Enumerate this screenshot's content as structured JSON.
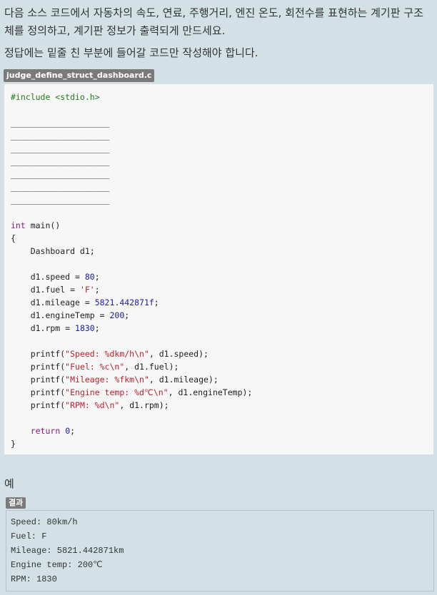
{
  "intro": {
    "paragraph1": "다음 소스 코드에서 자동차의 속도, 연료, 주행거리, 엔진 온도, 회전수를 표현하는 계기판 구조체를 정의하고, 계기판 정보가 출력되게 만드세요.",
    "paragraph2": "정답에는 밑줄 친 부분에 들어갈 코드만 작성해야 합니다."
  },
  "code_file": {
    "filename": "judge_define_struct_dashboard.c",
    "lines": [
      [
        {
          "t": "#include <stdio.h>",
          "c": "pp"
        }
      ],
      [],
      [
        {
          "t": "____________________",
          "c": ""
        }
      ],
      [
        {
          "t": "____________________",
          "c": ""
        }
      ],
      [
        {
          "t": "____________________",
          "c": ""
        }
      ],
      [
        {
          "t": "____________________",
          "c": ""
        }
      ],
      [
        {
          "t": "____________________",
          "c": ""
        }
      ],
      [
        {
          "t": "____________________",
          "c": ""
        }
      ],
      [
        {
          "t": "____________________",
          "c": ""
        }
      ],
      [],
      [
        {
          "t": "int",
          "c": "kw"
        },
        {
          "t": " main()",
          "c": ""
        }
      ],
      [
        {
          "t": "{",
          "c": ""
        }
      ],
      [
        {
          "t": "    Dashboard d1;",
          "c": ""
        }
      ],
      [],
      [
        {
          "t": "    d1.speed = ",
          "c": ""
        },
        {
          "t": "80",
          "c": "num"
        },
        {
          "t": ";",
          "c": ""
        }
      ],
      [
        {
          "t": "    d1.fuel = ",
          "c": ""
        },
        {
          "t": "'F'",
          "c": "str"
        },
        {
          "t": ";",
          "c": ""
        }
      ],
      [
        {
          "t": "    d1.mileage = ",
          "c": ""
        },
        {
          "t": "5821.442871f",
          "c": "num"
        },
        {
          "t": ";",
          "c": ""
        }
      ],
      [
        {
          "t": "    d1.engineTemp = ",
          "c": ""
        },
        {
          "t": "200",
          "c": "num"
        },
        {
          "t": ";",
          "c": ""
        }
      ],
      [
        {
          "t": "    d1.rpm = ",
          "c": ""
        },
        {
          "t": "1830",
          "c": "num"
        },
        {
          "t": ";",
          "c": ""
        }
      ],
      [],
      [
        {
          "t": "    printf(",
          "c": ""
        },
        {
          "t": "\"Speed: %dkm/h\\n\"",
          "c": "str"
        },
        {
          "t": ", d1.speed);",
          "c": ""
        }
      ],
      [
        {
          "t": "    printf(",
          "c": ""
        },
        {
          "t": "\"Fuel: %c\\n\"",
          "c": "str"
        },
        {
          "t": ", d1.fuel);",
          "c": ""
        }
      ],
      [
        {
          "t": "    printf(",
          "c": ""
        },
        {
          "t": "\"Mileage: %fkm\\n\"",
          "c": "str"
        },
        {
          "t": ", d1.mileage);",
          "c": ""
        }
      ],
      [
        {
          "t": "    printf(",
          "c": ""
        },
        {
          "t": "\"Engine temp: %d℃\\n\"",
          "c": "str"
        },
        {
          "t": ", d1.engineTemp);",
          "c": ""
        }
      ],
      [
        {
          "t": "    printf(",
          "c": ""
        },
        {
          "t": "\"RPM: %d\\n\"",
          "c": "str"
        },
        {
          "t": ", d1.rpm);",
          "c": ""
        }
      ],
      [],
      [
        {
          "t": "    ",
          "c": ""
        },
        {
          "t": "return",
          "c": "kw"
        },
        {
          "t": " ",
          "c": ""
        },
        {
          "t": "0",
          "c": "num"
        },
        {
          "t": ";",
          "c": ""
        }
      ],
      [
        {
          "t": "}",
          "c": ""
        }
      ]
    ]
  },
  "example": {
    "heading": "예",
    "result_label": "결과",
    "output_lines": [
      "Speed: 80km/h",
      "Fuel: F",
      "Mileage: 5821.442871km",
      "Engine temp: 200℃",
      "RPM: 1830"
    ]
  },
  "colors": {
    "page_background": "#d3e1e6",
    "code_background": "#f7f7f7",
    "tag_background": "#7a7a7a",
    "keyword": "#8a1a8a",
    "string": "#b7232d",
    "number": "#1a1ab0",
    "preprocessor": "#1f7a1f"
  }
}
